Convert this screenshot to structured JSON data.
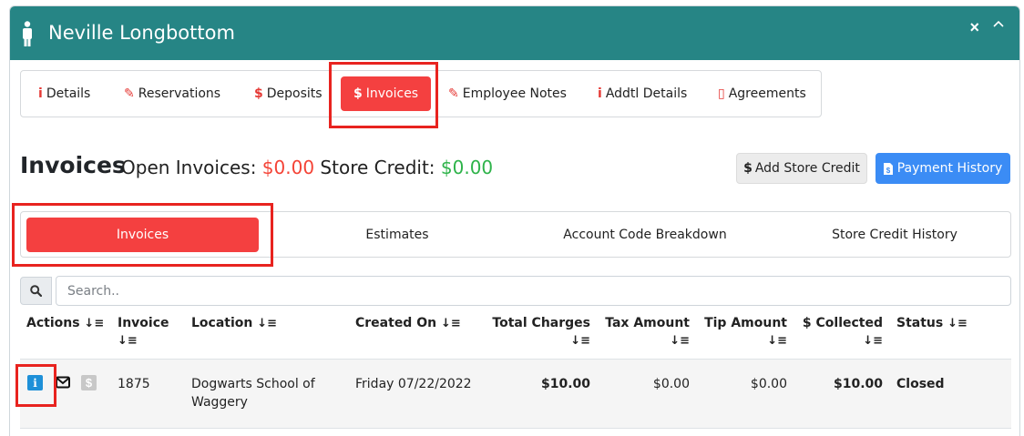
{
  "header": {
    "title": "Neville Longbottom",
    "close_glyph": "×"
  },
  "tabs": [
    {
      "icon": "i",
      "label": "Details"
    },
    {
      "icon": "✎",
      "label": "Reservations"
    },
    {
      "icon": "$",
      "label": "Deposits"
    },
    {
      "icon": "$",
      "label": "Invoices",
      "active": true
    },
    {
      "icon": "✎",
      "label": "Employee Notes"
    },
    {
      "icon": "i",
      "label": "Addtl Details"
    },
    {
      "icon": "▯",
      "label": "Agreements"
    }
  ],
  "invoices": {
    "heading": "Invoices",
    "open_label": "Open Invoices:",
    "open_value": "$0.00",
    "credit_label": "Store Credit:",
    "credit_value": "$0.00",
    "add_credit_button": "Add Store Credit",
    "payment_history_button": "Payment History"
  },
  "subtabs": [
    {
      "label": "Invoices",
      "active": true
    },
    {
      "label": "Estimates"
    },
    {
      "label": "Account Code Breakdown"
    },
    {
      "label": "Store Credit History"
    }
  ],
  "search": {
    "placeholder": "Search.."
  },
  "table": {
    "columns": {
      "actions": "Actions",
      "invoice": "Invoice",
      "location": "Location",
      "created_on": "Created On",
      "total_charges": "Total Charges",
      "tax_amount": "Tax Amount",
      "tip_amount": "Tip Amount",
      "collected": "$ Collected",
      "status": "Status"
    },
    "sort_glyph": "↓≡",
    "rows": [
      {
        "invoice": "1875",
        "location_line1": "Dogwarts School of",
        "location_line2": "Waggery",
        "created_on": "Friday 07/22/2022",
        "total_charges": "$10.00",
        "tax_amount": "$0.00",
        "tip_amount": "$0.00",
        "collected": "$10.00",
        "status": "Closed"
      }
    ]
  },
  "colors": {
    "header_bg": "#268585",
    "active_tab": "#f44040",
    "highlight": "#e8231f",
    "open_value": "#f44336",
    "credit_value": "#2eb34a",
    "primary_button": "#3b8cf5"
  }
}
